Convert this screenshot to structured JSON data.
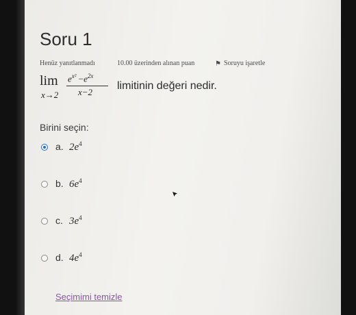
{
  "question": {
    "title": "Soru 1",
    "status": "Henüz yanıtlanmadı",
    "points": "10.00 üzerinden alınan puan",
    "flag_label": "Soruyu işaretle",
    "flag_icon": "flag-icon",
    "limit": {
      "lim": "lim",
      "subscript": "x→2",
      "num_base1": "e",
      "num_exp1": "x²",
      "num_minus": " −",
      "num_base2": "e",
      "num_exp2": "2x",
      "denominator": "x−2"
    },
    "text": "limitinin değeri nedir."
  },
  "answers": {
    "prompt": "Birini seçin:",
    "selected_index": 0,
    "options": [
      {
        "letter": "a.",
        "coef": "2e",
        "exp": "4"
      },
      {
        "letter": "b.",
        "coef": "6e",
        "exp": "4"
      },
      {
        "letter": "c.",
        "coef": "3e",
        "exp": "4"
      },
      {
        "letter": "d.",
        "coef": "4e",
        "exp": "4"
      }
    ],
    "clear_label": "Seçimimi temizle"
  },
  "colors": {
    "radio_selected": "#1f6fd6",
    "link": "#8a55a6"
  }
}
